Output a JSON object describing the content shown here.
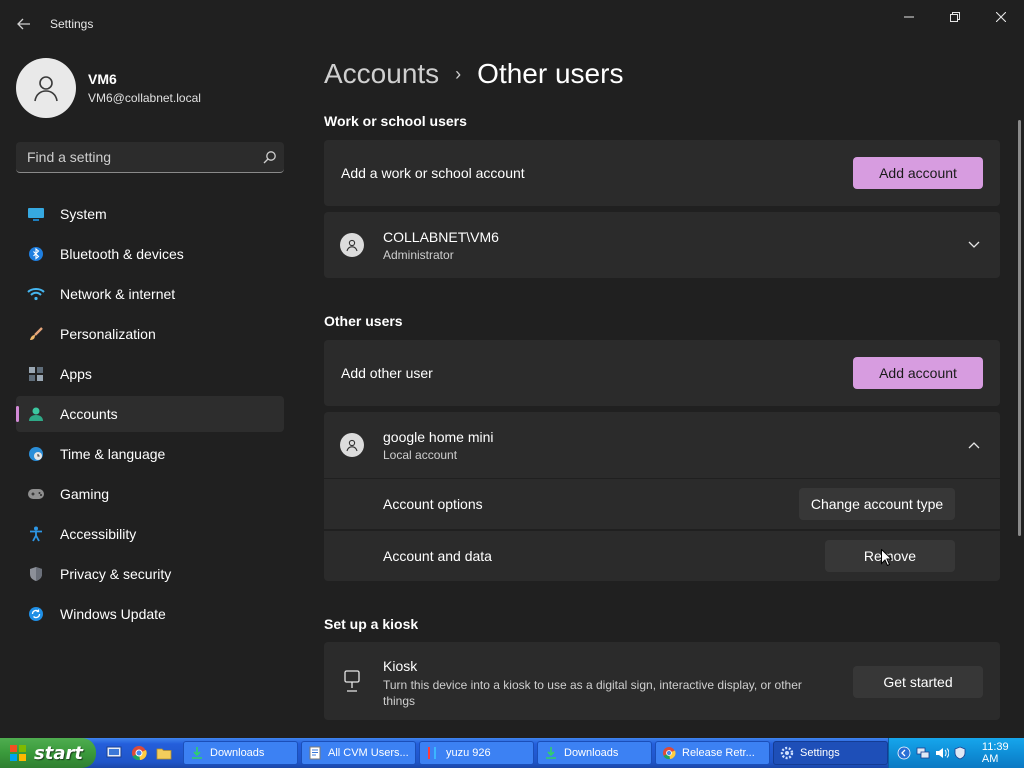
{
  "window": {
    "title": "Settings"
  },
  "profile": {
    "name": "VM6",
    "email": "VM6@collabnet.local"
  },
  "search": {
    "placeholder": "Find a setting"
  },
  "nav": {
    "items": [
      {
        "label": "System",
        "icon": "system-icon"
      },
      {
        "label": "Bluetooth & devices",
        "icon": "bluetooth-icon"
      },
      {
        "label": "Network & internet",
        "icon": "wifi-icon"
      },
      {
        "label": "Personalization",
        "icon": "brush-icon"
      },
      {
        "label": "Apps",
        "icon": "apps-icon"
      },
      {
        "label": "Accounts",
        "icon": "accounts-icon",
        "active": true
      },
      {
        "label": "Time & language",
        "icon": "globe-clock-icon"
      },
      {
        "label": "Gaming",
        "icon": "gamepad-icon"
      },
      {
        "label": "Accessibility",
        "icon": "accessibility-icon"
      },
      {
        "label": "Privacy & security",
        "icon": "shield-icon"
      },
      {
        "label": "Windows Update",
        "icon": "update-icon"
      }
    ]
  },
  "breadcrumb": {
    "parent": "Accounts",
    "separator": "›",
    "current": "Other users"
  },
  "work_school": {
    "title": "Work or school users",
    "add_label": "Add a work or school account",
    "add_button": "Add account",
    "user": {
      "name": "COLLABNET\\VM6",
      "role": "Administrator"
    }
  },
  "other_users": {
    "title": "Other users",
    "add_label": "Add other user",
    "add_button": "Add account",
    "user": {
      "name": "google home mini",
      "role": "Local account",
      "options_label": "Account options",
      "options_button": "Change account type",
      "data_label": "Account and data",
      "data_button": "Remove"
    }
  },
  "kiosk": {
    "title": "Set up a kiosk",
    "name": "Kiosk",
    "description": "Turn this device into a kiosk to use as a digital sign, interactive display, or other things",
    "button": "Get started"
  },
  "taskbar": {
    "start_label": "start",
    "tasks": [
      {
        "label": "Downloads",
        "icon": "download-folder-icon"
      },
      {
        "label": "All CVM Users...",
        "icon": "document-icon"
      },
      {
        "label": "yuzu 926",
        "icon": "yuzu-icon"
      },
      {
        "label": "Downloads",
        "icon": "download-folder-icon"
      },
      {
        "label": "Release Retr...",
        "icon": "chrome-icon"
      },
      {
        "label": "Settings",
        "icon": "gear-icon",
        "active": true
      }
    ],
    "clock": "11:39 AM"
  },
  "colors": {
    "accent": "#d79ce0",
    "background": "#202020",
    "card": "#2b2b2b"
  }
}
